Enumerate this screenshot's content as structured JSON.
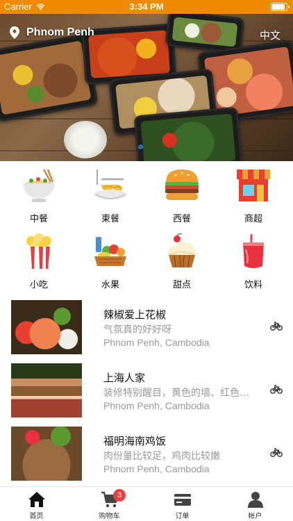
{
  "status_bar": {
    "carrier": "Carrier",
    "time": "3:34 PM"
  },
  "header": {
    "location": "Phnom Penh",
    "language": "中文"
  },
  "categories": [
    {
      "label": "中餐",
      "icon": "noodle-bowl-icon"
    },
    {
      "label": "柬餐",
      "icon": "noodle-plate-icon"
    },
    {
      "label": "西餐",
      "icon": "burger-icon"
    },
    {
      "label": "商超",
      "icon": "store-icon"
    },
    {
      "label": "小吃",
      "icon": "popcorn-icon"
    },
    {
      "label": "水果",
      "icon": "fruit-basket-icon"
    },
    {
      "label": "甜点",
      "icon": "cupcake-icon"
    },
    {
      "label": "饮料",
      "icon": "drink-icon"
    }
  ],
  "restaurants": [
    {
      "name": "辣椒爱上花椒",
      "description": "气氛真的好好呀",
      "address": "Phnom Penh, Cambodia",
      "delivery_icon": "bicycle-icon"
    },
    {
      "name": "上海人家",
      "description": "装修特别醒目，黄色的墙、红色的柱子",
      "address": "Phnom Penh, Cambodia",
      "delivery_icon": "bicycle-icon"
    },
    {
      "name": "福明海南鸡饭",
      "description": "肉份量比较足，鸡肉比较嫩",
      "address": "Phnom Penh, Cambodia",
      "delivery_icon": "bicycle-icon"
    }
  ],
  "tabbar": {
    "home": "首页",
    "cart": "购物车",
    "cart_badge": "3",
    "orders": "订单",
    "account": "帐户"
  },
  "colors": {
    "status_bar": "#f08a00",
    "badge": "#e84040",
    "page_dot": "#2a6ab8"
  }
}
